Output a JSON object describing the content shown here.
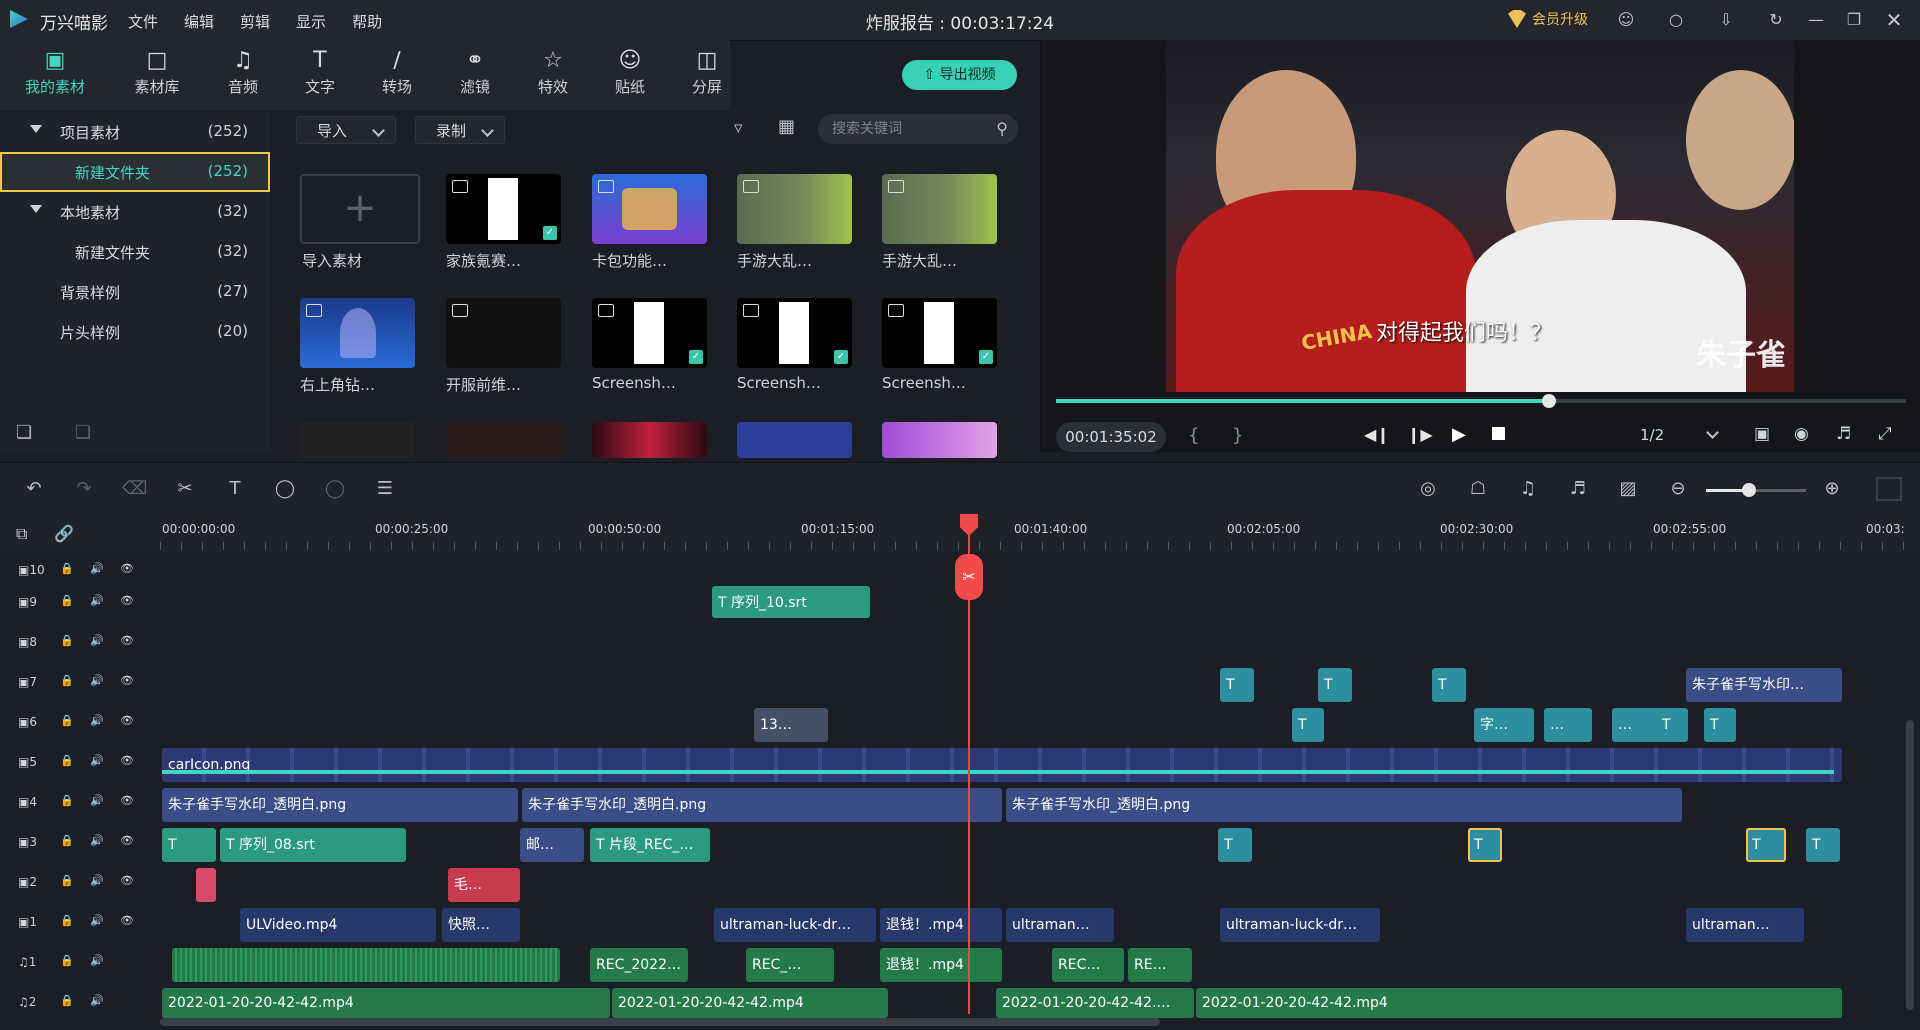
{
  "app": {
    "name": "万兴喵影",
    "menu": [
      "文件",
      "编辑",
      "剪辑",
      "显示",
      "帮助"
    ],
    "project_title": "炸服报告 : 00:03:17:24",
    "vip_label": "会员升级"
  },
  "window_controls": [
    "user-icon",
    "message-icon",
    "download-icon",
    "refresh-icon",
    "minimize-icon",
    "restore-icon",
    "close-icon"
  ],
  "main_tabs": [
    {
      "label": "我的素材",
      "icon": "box-icon",
      "active": true
    },
    {
      "label": "素材库",
      "icon": "folder-icon"
    },
    {
      "label": "音频",
      "icon": "music-icon"
    },
    {
      "label": "文字",
      "icon": "text-icon"
    },
    {
      "label": "转场",
      "icon": "transition-icon"
    },
    {
      "label": "滤镜",
      "icon": "filter-icon"
    },
    {
      "label": "特效",
      "icon": "effect-icon"
    },
    {
      "label": "贴纸",
      "icon": "sticker-icon"
    },
    {
      "label": "分屏",
      "icon": "split-icon"
    }
  ],
  "export_label": "导出视频",
  "tree": [
    {
      "label": "项目素材",
      "count": "(252)",
      "expanded": true
    },
    {
      "label": "新建文件夹",
      "count": "(252)",
      "selected": true
    },
    {
      "label": "本地素材",
      "count": "(32)",
      "expanded": true
    },
    {
      "label": "新建文件夹",
      "count": "(32)"
    },
    {
      "label": "背景样例",
      "count": "(27)"
    },
    {
      "label": "片头样例",
      "count": "(20)"
    }
  ],
  "media_toolbar": {
    "import_label": "导入",
    "record_label": "录制",
    "search_placeholder": "搜索关键词"
  },
  "media_items": [
    {
      "caption": "导入素材",
      "type": "import"
    },
    {
      "caption": "家族氪赛…",
      "checked": true
    },
    {
      "caption": "卡包功能…"
    },
    {
      "caption": "手游大乱…"
    },
    {
      "caption": "手游大乱…"
    },
    {
      "caption": "右上角钻…"
    },
    {
      "caption": "开服前维…"
    },
    {
      "caption": "Screensh…",
      "checked": true
    },
    {
      "caption": "Screensh…",
      "checked": true
    },
    {
      "caption": "Screensh…",
      "checked": true
    }
  ],
  "preview": {
    "subtitle": "对得起我们吗！？",
    "watermark": "朱子雀",
    "shirt_text": "CHINA",
    "timecode": "00:01:35:02",
    "brace_left": "{",
    "brace_right": "}",
    "ratio": "1/2",
    "progress": 0.58
  },
  "ruler": [
    "00:00:00:00",
    "00:00:25:00",
    "00:00:50:00",
    "00:01:15:00",
    "00:01:40:00",
    "00:02:05:00",
    "00:02:30:00",
    "00:02:55:00",
    "00:03:"
  ],
  "tracks": [
    "10",
    "9",
    "8",
    "7",
    "6",
    "5",
    "4",
    "3",
    "2",
    "1",
    "1",
    "2"
  ],
  "clips": {
    "t9": "序列_10.srt",
    "t7": "朱子雀手写水印…",
    "t6": "13…",
    "t6b": "字…",
    "t5": "carIcon.png",
    "t4a": "朱子雀手写水印_透明白.png",
    "t4b": "朱子雀手写水印_透明白.png",
    "t4c": "朱子雀手写水印_透明白.png",
    "t3a": "序列_08.srt",
    "t3b": "邮…",
    "t3c": "片段_REC_…",
    "t2a": "毛…",
    "v1a": "ULVideo.mp4",
    "v1b": "快照…",
    "v1c": "ultraman-luck-dr…",
    "v1d": "退钱！.mp4",
    "v1e": "ultraman…",
    "v1f": "ultraman-luck-dr…",
    "v1g": "ultraman…",
    "a1a": "REC_2022…",
    "a1b": "REC_…",
    "a1c": "退钱！.mp4",
    "a1d": "REC…",
    "a1e": "RE…",
    "a2a": "2022-01-20-20-42-42.mp4",
    "a2b": "2022-01-20-20-42-42.mp4",
    "a2c": "2022-01-20-20-42-42.…",
    "a2d": "2022-01-20-20-42-42.mp4",
    "dots": "…",
    "T": "T"
  }
}
